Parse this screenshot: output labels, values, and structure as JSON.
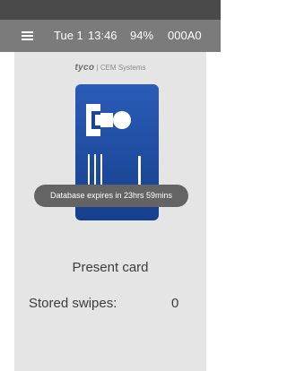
{
  "header": {
    "date": "Tue 1",
    "time": "13:46",
    "battery": "94%",
    "device_id": "000A0",
    "menu_icon": "hamburger-menu-icon"
  },
  "branding": {
    "brand": "tyco",
    "divider": "|",
    "subtitle": "CEM Systems"
  },
  "card_graphic": {
    "icon": "access-card-icon",
    "colors": {
      "card": "#1f4fa8",
      "card_dark": "#123579",
      "mark": "#ffffff"
    }
  },
  "toast": {
    "message": "Database expires in 23hrs 59mins"
  },
  "main": {
    "prompt": "Present card",
    "stored_label": "Stored swipes:",
    "stored_value": "0"
  },
  "colors": {
    "header_bg": "#7b7b7b",
    "status_bg": "#4a4a4a",
    "content_bg": "#e5e5e5",
    "toast_bg": "#646464"
  }
}
